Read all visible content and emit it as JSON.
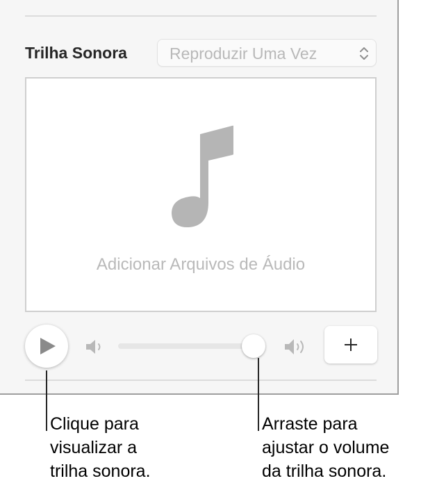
{
  "soundtrack": {
    "title": "Trilha Sonora",
    "playback_mode": {
      "selected": "Reproduzir Uma Vez",
      "icon": "chevron-up-down-icon"
    },
    "dropzone": {
      "icon": "music-note-icon",
      "label": "Adicionar Arquivos de Áudio"
    },
    "controls": {
      "play_icon": "play-icon",
      "volume_low_icon": "speaker-low-icon",
      "volume_high_icon": "speaker-high-icon",
      "add_icon": "plus-icon",
      "volume_level": 0.93
    }
  },
  "callouts": {
    "play": {
      "lines": [
        "Clique para",
        "visualizar a",
        "trilha sonora."
      ]
    },
    "volume": {
      "lines": [
        "Arraste para",
        "ajustar o volume",
        "da trilha sonora."
      ]
    }
  },
  "colors": {
    "panel_bg": "#f6f6f6",
    "icon_gray": "#b5b5b5",
    "text_dark": "#262626",
    "placeholder_gray": "#b9b9b9"
  }
}
